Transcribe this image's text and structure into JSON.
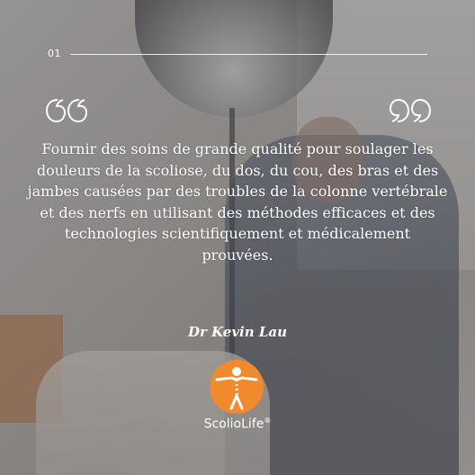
{
  "slide": {
    "number": "01",
    "quote": "Fournir des soins de grande qualité pour soulager les douleurs de la scoliose, du dos, du cou, des bras et des jambes causées par des troubles de la colonne vertébrale et des nerfs en utilisant des méthodes efficaces et des technologies scientifiquement et médicalement prouvées.",
    "author": "Dr Kevin Lau"
  },
  "brand": {
    "name": "ScolioLife",
    "registered": "®",
    "color": "#f08a2c"
  },
  "icons": {
    "open_quote": "quote-open-icon",
    "close_quote": "quote-close-icon",
    "logo": "spine-figure-logo"
  }
}
